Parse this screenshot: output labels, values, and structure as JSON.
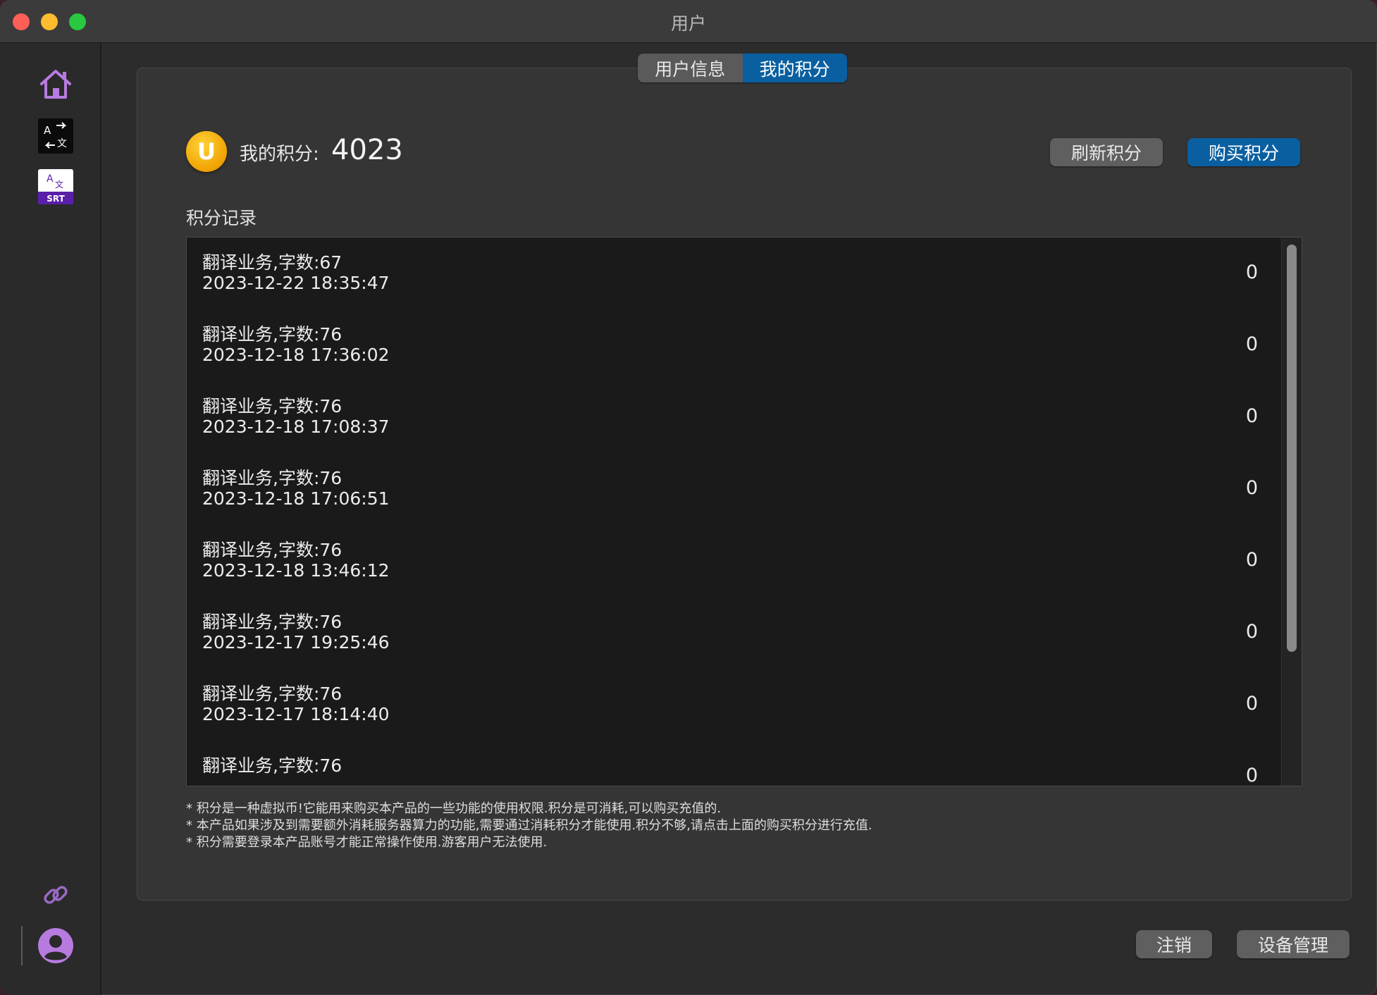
{
  "window": {
    "title": "用户"
  },
  "sidebar": {
    "items": [
      {
        "name": "home",
        "icon": "home-icon"
      },
      {
        "name": "translate",
        "icon": "translate-icon"
      },
      {
        "name": "srt",
        "icon": "srt-translate-icon",
        "label": "SRT"
      }
    ],
    "bottom": [
      {
        "name": "link",
        "icon": "link-icon"
      },
      {
        "name": "user",
        "icon": "user-avatar-icon"
      }
    ]
  },
  "tabs": [
    {
      "label": "用户信息",
      "active": false
    },
    {
      "label": "我的积分",
      "active": true
    }
  ],
  "points": {
    "coin_letter": "U",
    "label": "我的积分:",
    "value": "4023",
    "refresh_label": "刷新积分",
    "buy_label": "购买积分"
  },
  "records": {
    "title": "积分记录",
    "rows": [
      {
        "desc": "翻译业务,字数:67",
        "time": "2023-12-22 18:35:47",
        "value": "0"
      },
      {
        "desc": "翻译业务,字数:76",
        "time": "2023-12-18 17:36:02",
        "value": "0"
      },
      {
        "desc": "翻译业务,字数:76",
        "time": "2023-12-18 17:08:37",
        "value": "0"
      },
      {
        "desc": "翻译业务,字数:76",
        "time": "2023-12-18 17:06:51",
        "value": "0"
      },
      {
        "desc": "翻译业务,字数:76",
        "time": "2023-12-18 13:46:12",
        "value": "0"
      },
      {
        "desc": "翻译业务,字数:76",
        "time": "2023-12-17 19:25:46",
        "value": "0"
      },
      {
        "desc": "翻译业务,字数:76",
        "time": "2023-12-17 18:14:40",
        "value": "0"
      },
      {
        "desc": "翻译业务,字数:76",
        "time": "",
        "value": "0"
      }
    ]
  },
  "notes": [
    "* 积分是一种虚拟币!它能用来购买本产品的一些功能的使用权限.积分是可消耗,可以购买充值的.",
    "* 本产品如果涉及到需要额外消耗服务器算力的功能,需要通过消耗积分才能使用.积分不够,请点击上面的购买积分进行充值.",
    "* 积分需要登录本产品账号才能正常操作使用.游客用户无法使用."
  ],
  "footer": {
    "logout_label": "注销",
    "device_label": "设备管理"
  },
  "colors": {
    "accent": "#0a5fa0",
    "coin": "#f0a200",
    "sidebar_icon": "#b77be0"
  }
}
